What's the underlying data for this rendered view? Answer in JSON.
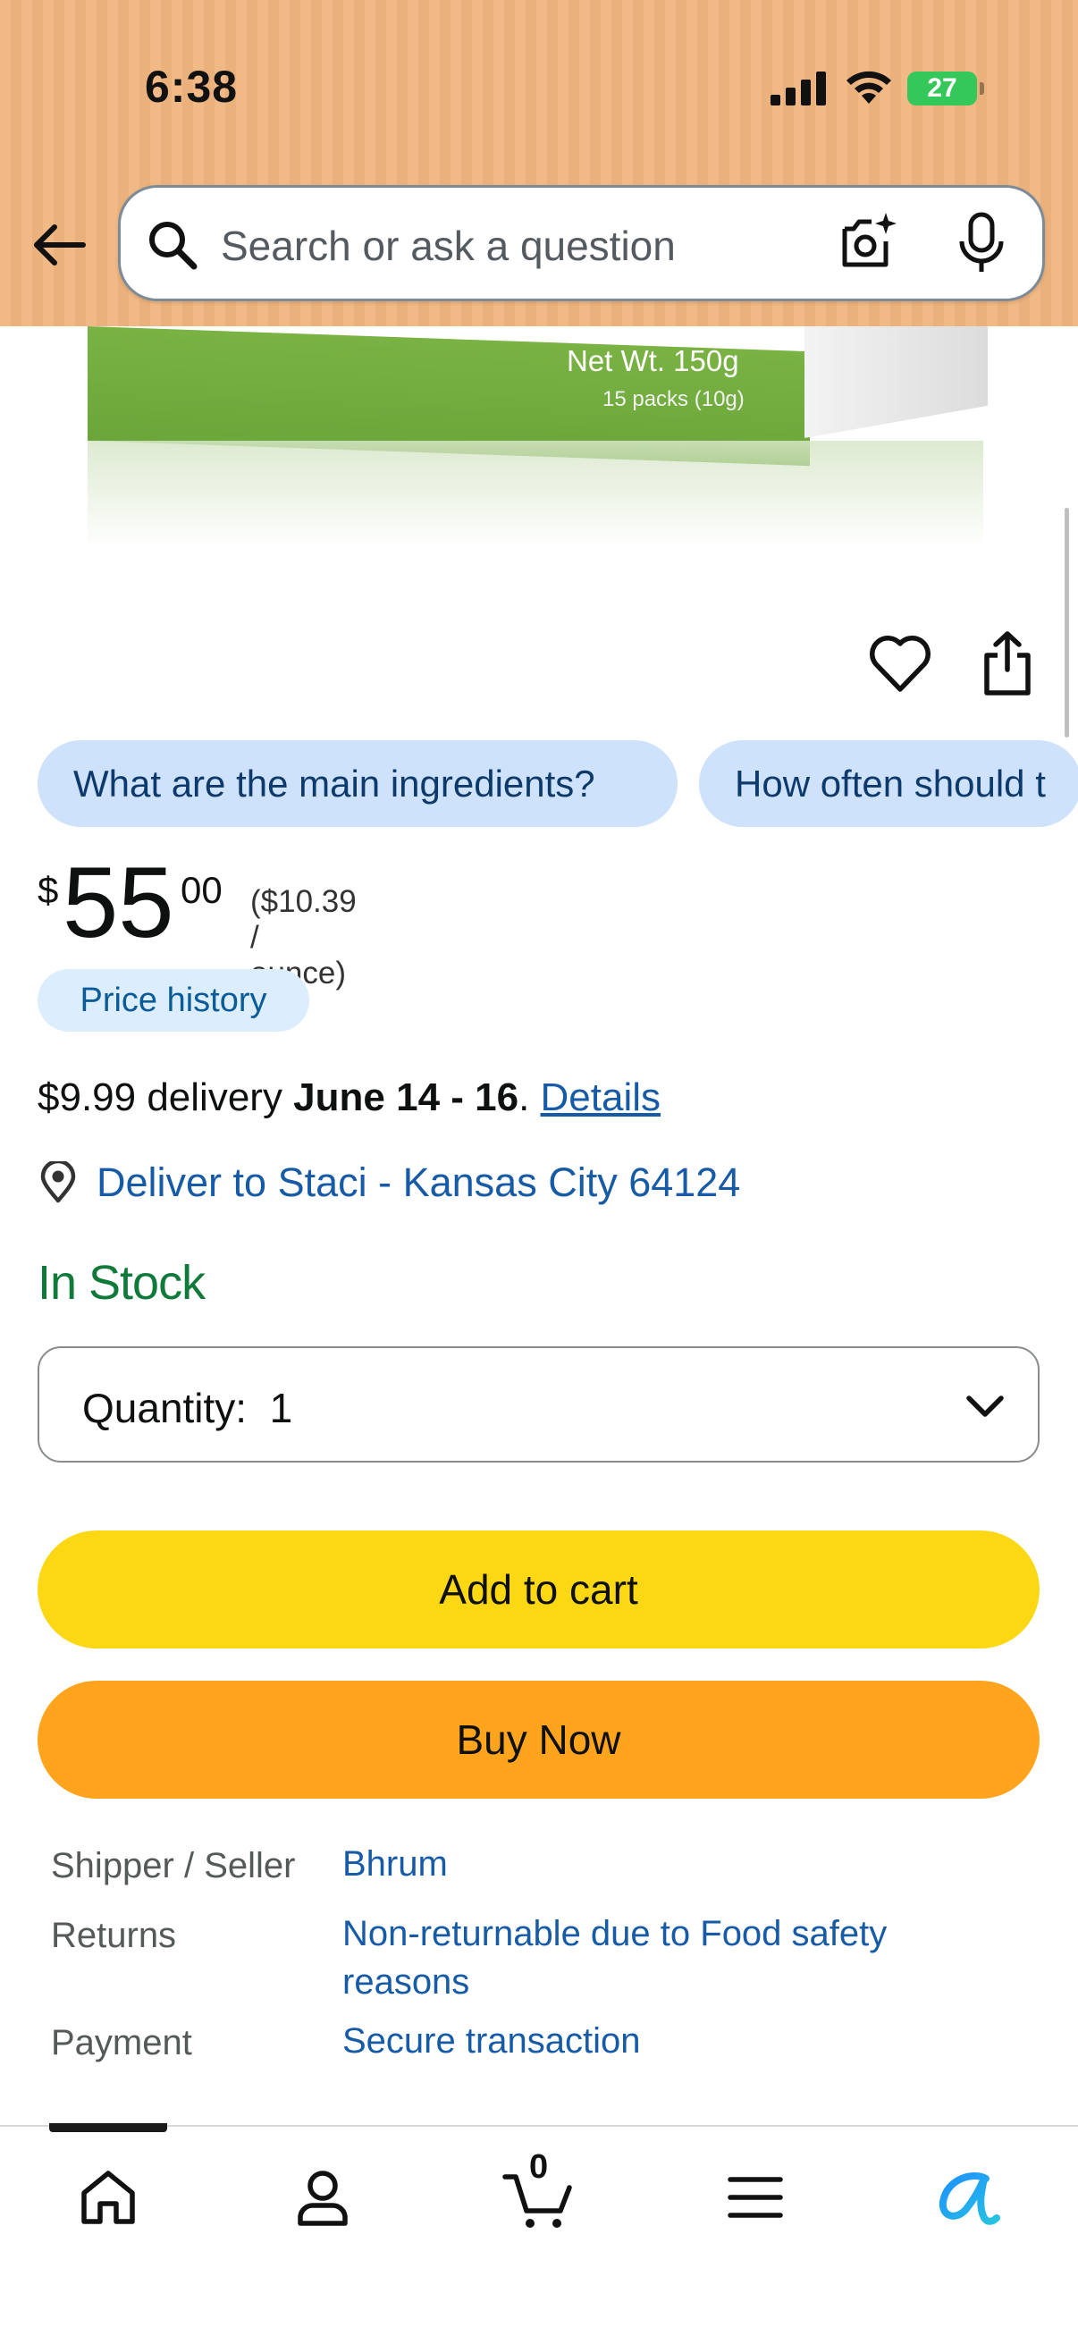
{
  "status_bar": {
    "time": "6:38",
    "battery": "27"
  },
  "search": {
    "placeholder": "Search or ask a question"
  },
  "product_image": {
    "net_weight": "Net Wt. 150g",
    "packs": "15 packs (10g)"
  },
  "questions": [
    "What are the main ingredients?",
    "How often should t"
  ],
  "price": {
    "symbol": "$",
    "whole": "55",
    "fraction": "00",
    "unit_price": "($10.39 / ounce)"
  },
  "price_history_label": "Price history",
  "delivery": {
    "fee_text": "$9.99 delivery ",
    "dates": "June 14 - 16",
    "separator": ". ",
    "details_link": "Details"
  },
  "deliver_to": "Deliver to Staci - Kansas City 64124",
  "stock_status": "In Stock",
  "quantity": {
    "label": "Quantity:",
    "value": "1"
  },
  "buttons": {
    "add_to_cart": "Add to cart",
    "buy_now": "Buy Now"
  },
  "info": [
    {
      "key": "Shipper / Seller",
      "value": "Bhrum"
    },
    {
      "key": "Returns",
      "value": "Non-returnable due to Food safety reasons"
    },
    {
      "key": "Payment",
      "value": "Secure transaction"
    }
  ],
  "cart_count": "0",
  "colors": {
    "header_bg": "#f0b57f",
    "link": "#175ba6",
    "in_stock": "#107a3a",
    "add_to_cart": "#fcd814",
    "buy_now": "#ffa41c",
    "chip_bg": "#cfe2fb"
  },
  "icons": {
    "back": "back-arrow-icon",
    "search": "search-icon",
    "camera": "camera-search-icon",
    "mic": "mic-icon",
    "wishlist": "heart-icon",
    "share": "share-icon",
    "location": "location-pin-icon",
    "quantity": "chevron-down-icon",
    "nav": [
      "home-icon",
      "account-icon",
      "cart-icon",
      "menu-icon",
      "rufus-icon"
    ]
  }
}
